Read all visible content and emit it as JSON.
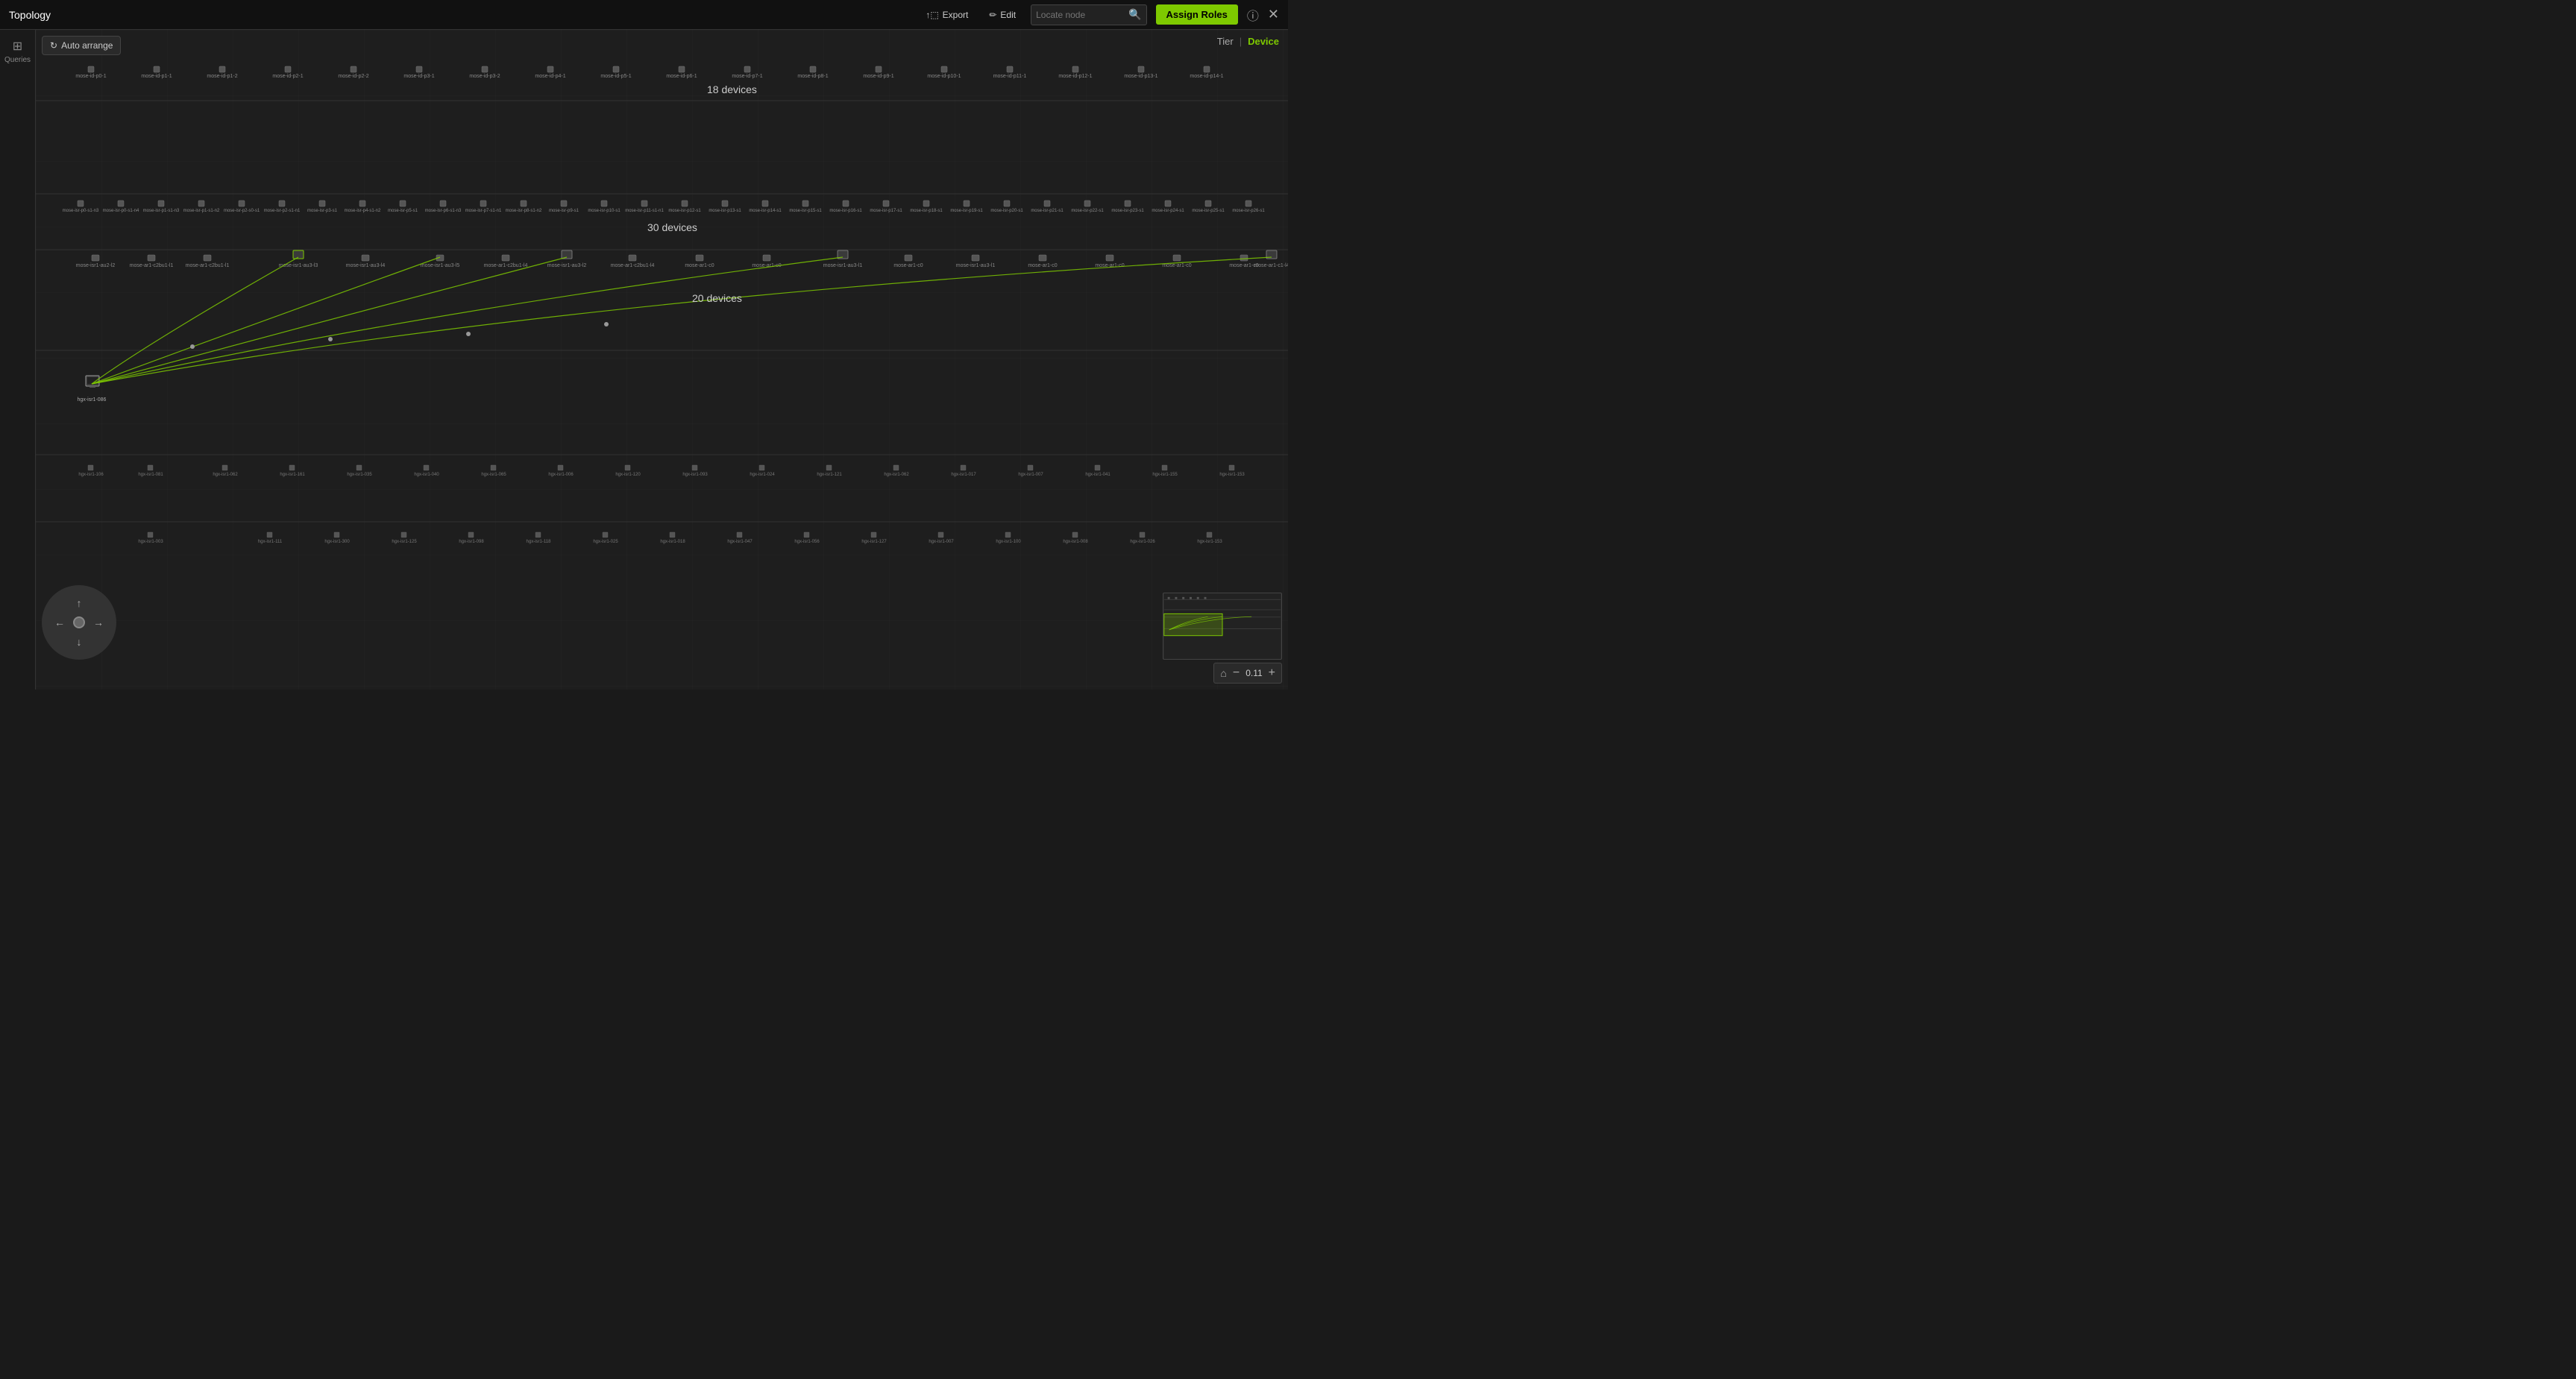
{
  "header": {
    "title": "Topology",
    "export_label": "Export",
    "edit_label": "Edit",
    "locate_placeholder": "Locate node",
    "assign_roles_label": "Assign Roles"
  },
  "sidebar": {
    "queries_label": "Queries"
  },
  "canvas": {
    "auto_arrange_label": "Auto arrange",
    "tier_label": "Tier",
    "device_label": "Device",
    "tier1_devices": "18 devices",
    "tier2_devices": "30 devices",
    "tier3_devices": "20 devices",
    "zoom_level": "0.11"
  },
  "nav": {
    "up": "↑",
    "down": "↓",
    "left": "←",
    "right": "→"
  }
}
